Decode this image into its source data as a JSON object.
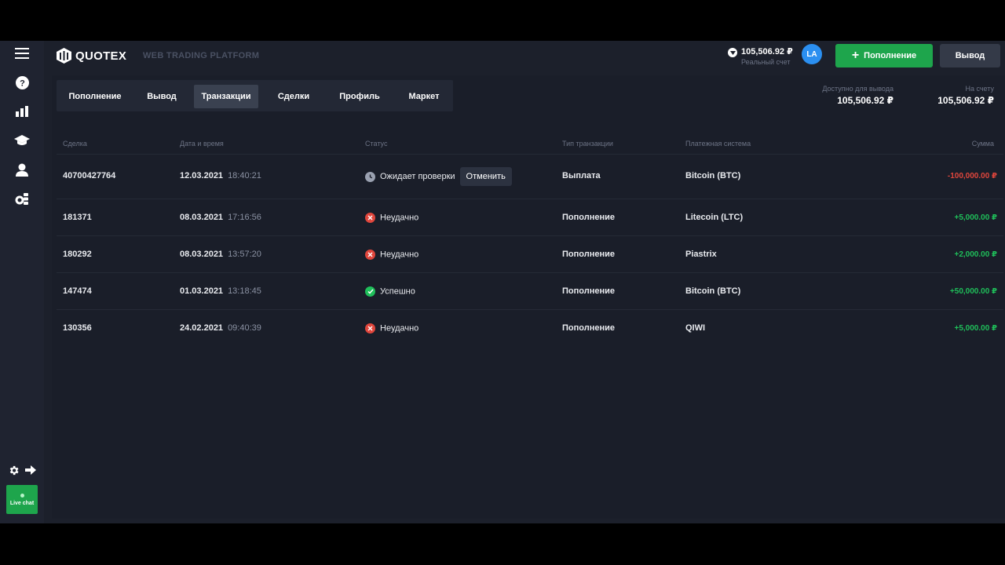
{
  "app": {
    "logo_text": "QUOTEX",
    "platform_label": "WEB TRADING PLATFORM",
    "balance": "105,506.92 ₽",
    "account_type": "Реальный счет",
    "avatar_initials": "LA",
    "deposit_button": "Пополнение",
    "withdraw_button": "Вывод"
  },
  "sidebar": {
    "icons": [
      "menu-icon",
      "help-icon",
      "chart-icon",
      "education-icon",
      "user-icon",
      "coins-icon"
    ],
    "settings_icon": "gear-icon",
    "logout_icon": "arrow-right-icon",
    "live_chat_label": "Live chat"
  },
  "tabs": [
    {
      "label": "Пополнение",
      "active": false
    },
    {
      "label": "Вывод",
      "active": false
    },
    {
      "label": "Транзакции",
      "active": true
    },
    {
      "label": "Сделки",
      "active": false
    },
    {
      "label": "Профиль",
      "active": false
    },
    {
      "label": "Маркет",
      "active": false
    }
  ],
  "summary": {
    "available_label": "Доступно для вывода",
    "available_value": "105,506.92 ₽",
    "account_label": "На счету",
    "account_value": "105,506.92 ₽"
  },
  "table": {
    "headers": {
      "deal": "Сделка",
      "datetime": "Дата и время",
      "status": "Статус",
      "type": "Тип транзакции",
      "system": "Платежная система",
      "amount": "Сумма"
    },
    "cancel_label": "Отменить",
    "rows": [
      {
        "id": "40700427764",
        "date": "12.03.2021",
        "time": "18:40:21",
        "status": "Ожидает проверки",
        "status_kind": "pending",
        "type": "Выплата",
        "system": "Bitcoin (BTC)",
        "amount": "-100,000.00 ₽"
      },
      {
        "id": "181371",
        "date": "08.03.2021",
        "time": "17:16:56",
        "status": "Неудачно",
        "status_kind": "failed",
        "type": "Пополнение",
        "system": "Litecoin (LTC)",
        "amount": "+5,000.00 ₽"
      },
      {
        "id": "180292",
        "date": "08.03.2021",
        "time": "13:57:20",
        "status": "Неудачно",
        "status_kind": "failed",
        "type": "Пополнение",
        "system": "Piastrix",
        "amount": "+2,000.00 ₽"
      },
      {
        "id": "147474",
        "date": "01.03.2021",
        "time": "13:18:45",
        "status": "Успешно",
        "status_kind": "success",
        "type": "Пополнение",
        "system": "Bitcoin (BTC)",
        "amount": "+50,000.00 ₽"
      },
      {
        "id": "130356",
        "date": "24.02.2021",
        "time": "09:40:39",
        "status": "Неудачно",
        "status_kind": "failed",
        "type": "Пополнение",
        "system": "QIWI",
        "amount": "+5,000.00 ₽"
      }
    ]
  },
  "colors": {
    "positive": "#1fbf5a",
    "negative": "#e0463c",
    "pending": "#9aa1b0",
    "accent": "#1ea54c"
  }
}
